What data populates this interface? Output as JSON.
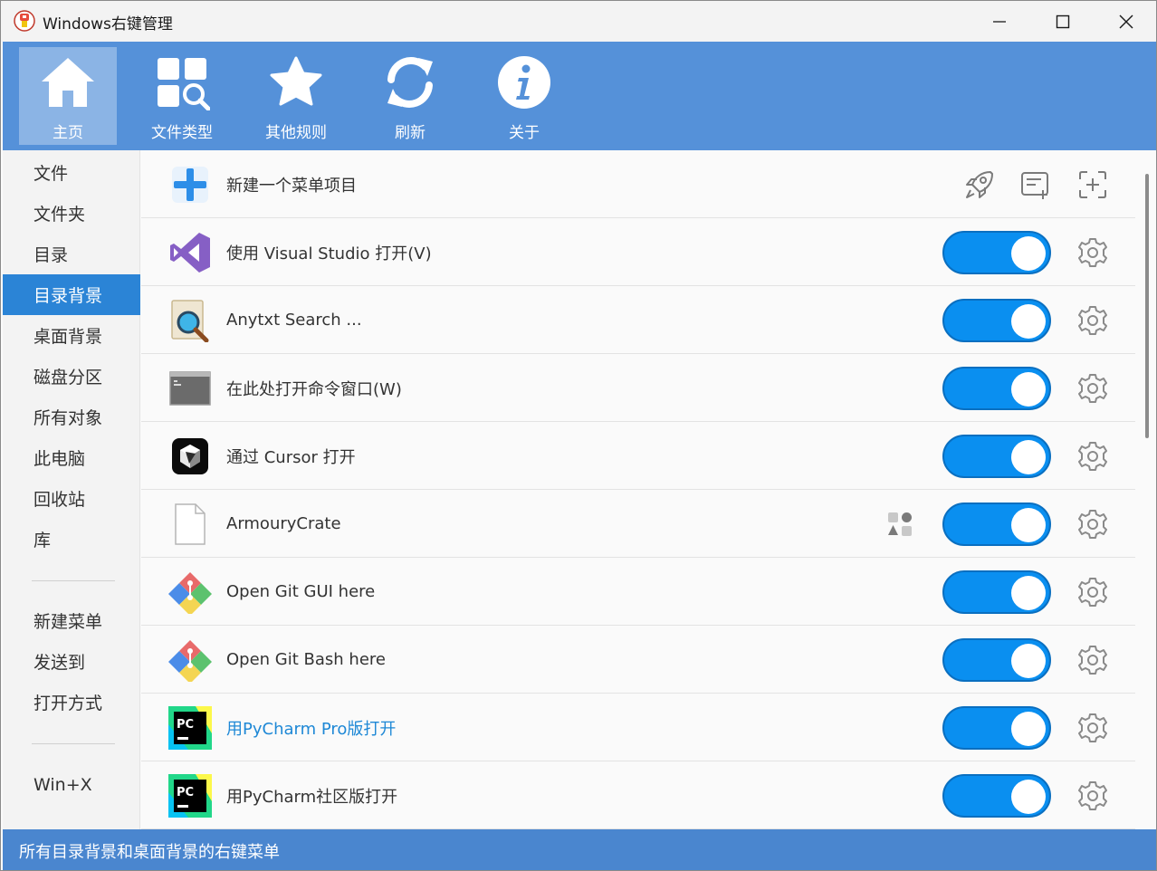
{
  "window": {
    "title": "Windows右键管理"
  },
  "toolbar": {
    "items": [
      {
        "label": "主页",
        "icon": "home-icon"
      },
      {
        "label": "文件类型",
        "icon": "file-types-icon"
      },
      {
        "label": "其他规则",
        "icon": "star-icon"
      },
      {
        "label": "刷新",
        "icon": "refresh-icon"
      },
      {
        "label": "关于",
        "icon": "info-icon"
      }
    ],
    "active_index": 0
  },
  "sidebar": {
    "items": [
      "文件",
      "文件夹",
      "目录",
      "目录背景",
      "桌面背景",
      "磁盘分区",
      "所有对象",
      "此电脑",
      "回收站",
      "库",
      "新建菜单",
      "发送到",
      "打开方式",
      "Win+X"
    ],
    "active": "目录背景"
  },
  "content": {
    "header": {
      "label": "新建一个菜单项目",
      "icon": "add-icon"
    },
    "rows": [
      {
        "label": "使用 Visual Studio 打开(V)",
        "icon": "visual-studio-icon",
        "enabled": true
      },
      {
        "label": "Anytxt Search ...",
        "icon": "anytxt-search-icon",
        "enabled": true
      },
      {
        "label": "在此处打开命令窗口(W)",
        "icon": "command-prompt-icon",
        "enabled": true
      },
      {
        "label": "通过 Cursor 打开",
        "icon": "cursor-icon",
        "enabled": true
      },
      {
        "label": "ArmouryCrate",
        "icon": "blank-file-icon",
        "enabled": true,
        "extra": "shapes-icon"
      },
      {
        "label": "Open Git GUI here",
        "icon": "git-icon",
        "enabled": true
      },
      {
        "label": "Open Git Bash here",
        "icon": "git-icon",
        "enabled": true
      },
      {
        "label": "用PyCharm Pro版打开",
        "icon": "pycharm-icon",
        "enabled": true,
        "highlight": true
      },
      {
        "label": "用PyCharm社区版打开",
        "icon": "pycharm-icon",
        "enabled": true
      }
    ]
  },
  "status": {
    "text": "所有目录背景和桌面背景的右键菜单"
  },
  "colors": {
    "toolbar_bg": "#5591d9",
    "sidebar_active": "#2b84d6",
    "toggle_on": "#0a8ff0",
    "status_bg": "#4a86cf",
    "link": "#1e88d6"
  }
}
